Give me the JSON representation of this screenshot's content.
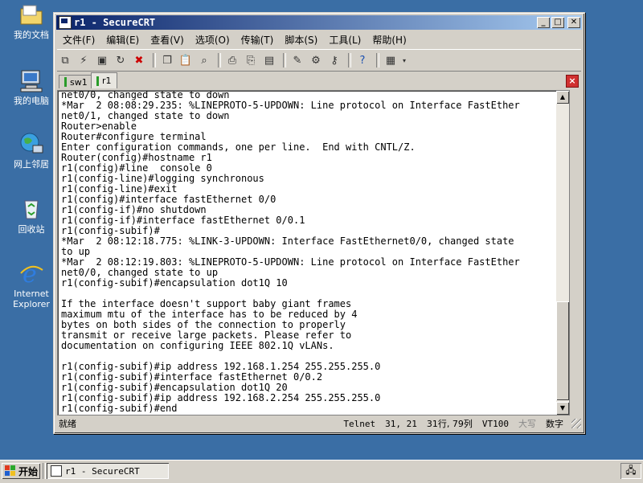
{
  "desktop": {
    "icons": [
      {
        "label": "我的文档",
        "icon": "my-documents-folder"
      },
      {
        "label": "我的电脑",
        "icon": "my-computer"
      },
      {
        "label": "网上邻居",
        "icon": "network-places"
      },
      {
        "label": "回收站",
        "icon": "recycle-bin"
      },
      {
        "label": "Internet Explorer",
        "icon": "internet-explorer"
      }
    ]
  },
  "window": {
    "title": "r1 - SecureCRT",
    "buttons": {
      "minimize": "_",
      "maximize": "□",
      "close": "✕"
    }
  },
  "menu": [
    "文件(F)",
    "编辑(E)",
    "查看(V)",
    "选项(O)",
    "传输(T)",
    "脚本(S)",
    "工具(L)",
    "帮助(H)"
  ],
  "tabs": [
    {
      "label": "sw1",
      "active": false
    },
    {
      "label": "r1",
      "active": true
    }
  ],
  "terminal": {
    "lines": [
      "net0/0, changed state to down",
      "*Mar  2 08:08:29.235: %LINEPROTO-5-UPDOWN: Line protocol on Interface FastEther",
      "net0/1, changed state to down",
      "Router>enable",
      "Router#configure terminal",
      "Enter configuration commands, one per line.  End with CNTL/Z.",
      "Router(config)#hostname r1",
      "r1(config)#line  console 0",
      "r1(config-line)#logging synchronous",
      "r1(config-line)#exit",
      "r1(config)#interface fastEthernet 0/0",
      "r1(config-if)#no shutdown",
      "r1(config-if)#interface fastEthernet 0/0.1",
      "r1(config-subif)#",
      "*Mar  2 08:12:18.775: %LINK-3-UPDOWN: Interface FastEthernet0/0, changed state",
      "to up",
      "*Mar  2 08:12:19.803: %LINEPROTO-5-UPDOWN: Line protocol on Interface FastEther",
      "net0/0, changed state to up",
      "r1(config-subif)#encapsulation dot1Q 10",
      "",
      "If the interface doesn't support baby giant frames",
      "maximum mtu of the interface has to be reduced by 4",
      "bytes on both sides of the connection to properly",
      "transmit or receive large packets. Please refer to",
      "documentation on configuring IEEE 802.1Q vLANs.",
      "",
      "r1(config-subif)#ip address 192.168.1.254 255.255.255.0",
      "r1(config-subif)#interface fastEthernet 0/0.2",
      "r1(config-subif)#encapsulation dot1Q 20",
      "r1(config-subif)#ip address 192.168.2.254 255.255.255.0",
      "r1(config-subif)#end"
    ]
  },
  "status": {
    "ready": "就绪",
    "protocol": "Telnet",
    "row_col": "31,  21",
    "lines_cols": "31行, 79列",
    "emulation": "VT100",
    "caps": "大写",
    "num": "数字"
  },
  "taskbar": {
    "start": "开始",
    "task": "r1 - SecureCRT"
  }
}
